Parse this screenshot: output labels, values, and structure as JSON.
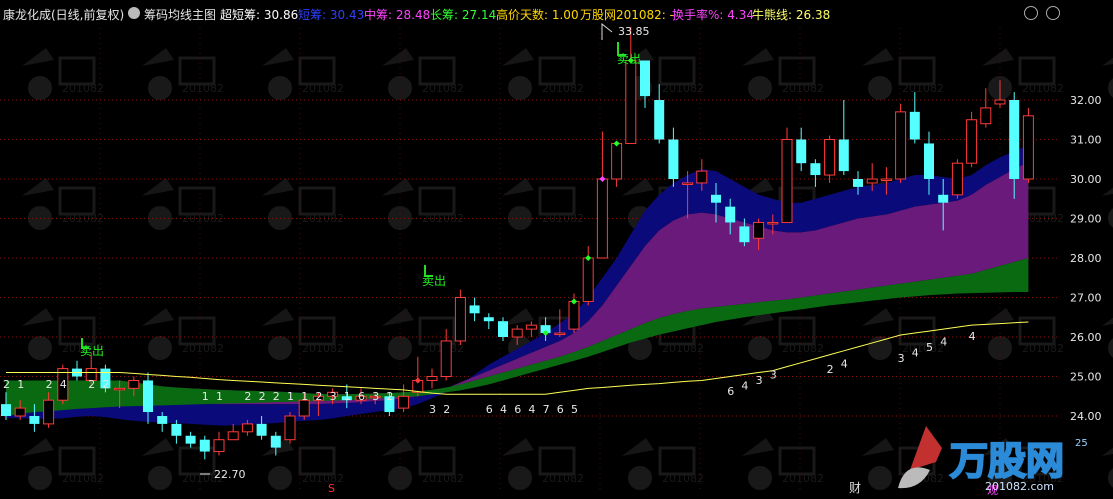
{
  "header": {
    "stock_name": "康龙化成(日线,前复权)",
    "indicator_name": "筹码均线主图",
    "items": [
      {
        "label": "超短筹: 30.86",
        "color": "#ffffff"
      },
      {
        "label": "短筹: 30.43",
        "color": "#3040ff"
      },
      {
        "label": "中筹: 28.48",
        "color": "#ff44ff"
      },
      {
        "label": "长筹: 27.14",
        "color": "#33ff33"
      },
      {
        "label": "高价天数: 1.00",
        "color": "#ffd700"
      },
      {
        "label": "万股网201082: -",
        "color": "#ffd700"
      },
      {
        "label": "换手率%: 4.34",
        "color": "#ff44ff"
      },
      {
        "label": "牛熊线: 26.38",
        "color": "#ffff66"
      }
    ]
  },
  "axis": {
    "y_labels": [
      "32.00",
      "31.00",
      "30.00",
      "29.00",
      "28.00",
      "27.00",
      "26.00",
      "25.00",
      "24.00"
    ],
    "partial_label": "25"
  },
  "annotations": {
    "high_price": "33.85",
    "low_price": "22.70",
    "sell_label": "卖出",
    "bottom_marker_s": "S",
    "bottom_marker_cai": "财",
    "bottom_marker_guan": "观"
  },
  "watermark": {
    "brand": "万股网",
    "url": "201082.com"
  },
  "chart_data": {
    "type": "candlestick",
    "ylim": [
      23.3,
      33.9
    ],
    "candles": [
      [
        24.3,
        24.0,
        24.6,
        23.9
      ],
      [
        24.0,
        24.2,
        24.4,
        23.9
      ],
      [
        24.0,
        23.8,
        24.3,
        23.6
      ],
      [
        23.8,
        24.4,
        24.6,
        23.7
      ],
      [
        24.4,
        25.2,
        25.3,
        24.3
      ],
      [
        25.2,
        25.0,
        25.4,
        24.9
      ],
      [
        24.9,
        25.2,
        25.6,
        24.8
      ],
      [
        25.2,
        24.7,
        25.3,
        24.6
      ],
      [
        24.7,
        24.7,
        24.9,
        24.2
      ],
      [
        24.7,
        24.9,
        25.0,
        24.5
      ],
      [
        24.9,
        24.1,
        25.1,
        23.8
      ],
      [
        24.0,
        23.8,
        24.1,
        23.6
      ],
      [
        23.8,
        23.5,
        23.9,
        23.3
      ],
      [
        23.5,
        23.3,
        23.6,
        23.2
      ],
      [
        23.4,
        23.1,
        23.5,
        22.9
      ],
      [
        23.1,
        23.4,
        23.6,
        23.0
      ],
      [
        23.4,
        23.6,
        23.8,
        23.4
      ],
      [
        23.6,
        23.8,
        23.9,
        23.5
      ],
      [
        23.8,
        23.5,
        24.0,
        23.4
      ],
      [
        23.5,
        23.2,
        23.6,
        23.0
      ],
      [
        23.4,
        24.0,
        24.1,
        23.3
      ],
      [
        24.0,
        24.4,
        24.6,
        23.9
      ],
      [
        24.4,
        24.5,
        24.6,
        24.0
      ],
      [
        24.5,
        24.6,
        24.7,
        24.3
      ],
      [
        24.5,
        24.4,
        24.8,
        24.2
      ],
      [
        24.4,
        24.5,
        24.7,
        24.3
      ],
      [
        24.5,
        24.5,
        24.6,
        24.3
      ],
      [
        24.5,
        24.1,
        24.6,
        24.0
      ],
      [
        24.2,
        24.5,
        24.8,
        24.1
      ],
      [
        24.6,
        24.9,
        25.5,
        24.5
      ],
      [
        24.9,
        25.0,
        25.2,
        24.7
      ],
      [
        25.0,
        25.9,
        26.2,
        24.9
      ],
      [
        25.9,
        27.0,
        27.2,
        25.8
      ],
      [
        26.8,
        26.6,
        27.0,
        26.4
      ],
      [
        26.5,
        26.4,
        26.6,
        26.2
      ],
      [
        26.4,
        26.0,
        26.5,
        25.9
      ],
      [
        26.0,
        26.2,
        26.3,
        25.8
      ],
      [
        26.2,
        26.3,
        26.4,
        26.0
      ],
      [
        26.3,
        26.1,
        26.5,
        25.9
      ],
      [
        26.1,
        26.1,
        26.7,
        26.0
      ],
      [
        26.2,
        26.9,
        27.1,
        26.1
      ],
      [
        26.9,
        28.0,
        28.3,
        26.8
      ],
      [
        28.0,
        30.0,
        31.2,
        28.0
      ],
      [
        30.0,
        30.9,
        30.9,
        29.8
      ],
      [
        30.9,
        33.0,
        33.85,
        30.9
      ],
      [
        33.0,
        32.1,
        32.3,
        31.8
      ],
      [
        32.0,
        31.0,
        32.4,
        30.9
      ],
      [
        31.0,
        30.0,
        31.3,
        29.8
      ],
      [
        29.9,
        29.9,
        30.2,
        29.0
      ],
      [
        29.9,
        30.2,
        30.5,
        29.7
      ],
      [
        29.6,
        29.4,
        29.9,
        28.9
      ],
      [
        29.3,
        28.9,
        29.5,
        28.6
      ],
      [
        28.8,
        28.4,
        29.0,
        28.3
      ],
      [
        28.5,
        28.9,
        29.0,
        28.2
      ],
      [
        28.9,
        28.9,
        29.1,
        28.6
      ],
      [
        28.9,
        31.0,
        31.3,
        28.9
      ],
      [
        31.0,
        30.4,
        31.3,
        30.2
      ],
      [
        30.4,
        30.1,
        30.5,
        29.8
      ],
      [
        30.1,
        31.0,
        31.1,
        29.9
      ],
      [
        31.0,
        30.2,
        32.0,
        30.1
      ],
      [
        30.0,
        29.8,
        30.2,
        29.6
      ],
      [
        29.9,
        30.0,
        30.4,
        29.7
      ],
      [
        30.0,
        30.0,
        30.3,
        29.6
      ],
      [
        30.0,
        31.7,
        31.9,
        29.9
      ],
      [
        31.7,
        31.0,
        32.2,
        30.9
      ],
      [
        30.9,
        30.0,
        31.2,
        29.6
      ],
      [
        29.6,
        29.4,
        30.0,
        28.7
      ],
      [
        29.6,
        30.4,
        30.5,
        29.5
      ],
      [
        30.4,
        31.5,
        31.7,
        30.3
      ],
      [
        31.4,
        31.8,
        32.3,
        31.3
      ],
      [
        31.9,
        32.0,
        32.5,
        31.8
      ],
      [
        32.0,
        30.0,
        32.2,
        29.5
      ],
      [
        30.0,
        31.6,
        31.8,
        29.9
      ]
    ],
    "bands": {
      "super_short": [
        23.95,
        23.94,
        23.93,
        23.93,
        23.94,
        23.98,
        24.0,
        23.97,
        23.92,
        23.88,
        23.85,
        23.83,
        23.82,
        23.8,
        23.78,
        23.76,
        23.76,
        23.77,
        23.8,
        23.82,
        23.85,
        23.88,
        23.9,
        23.94,
        24.0,
        24.05,
        24.1,
        24.15,
        24.2,
        24.3,
        24.45,
        24.6,
        24.8,
        25.05,
        25.3,
        25.5,
        25.7,
        25.9,
        26.1,
        26.35,
        26.6,
        27.0,
        27.5,
        28.0,
        28.6,
        29.2,
        29.6,
        29.9,
        30.1,
        30.25,
        30.2,
        30.0,
        29.8,
        29.6,
        29.5,
        29.4,
        29.4,
        29.5,
        29.6,
        29.7,
        29.8,
        29.85,
        29.9,
        30.0,
        30.1,
        30.1,
        30.05,
        30.0,
        30.1,
        30.35,
        30.55,
        30.7,
        30.86
      ],
      "short": [
        24.6,
        24.6,
        24.6,
        24.55,
        24.55,
        24.6,
        24.6,
        24.6,
        24.55,
        24.5,
        24.45,
        24.4,
        24.38,
        24.35,
        24.33,
        24.3,
        24.3,
        24.3,
        24.3,
        24.3,
        24.3,
        24.3,
        24.3,
        24.32,
        24.33,
        24.35,
        24.38,
        24.4,
        24.45,
        24.5,
        24.6,
        24.7,
        24.85,
        25.0,
        25.15,
        25.3,
        25.45,
        25.6,
        25.75,
        25.9,
        26.1,
        26.4,
        26.8,
        27.3,
        27.8,
        28.3,
        28.7,
        28.95,
        29.1,
        29.15,
        29.1,
        29.0,
        28.9,
        28.8,
        28.7,
        28.65,
        28.65,
        28.7,
        28.8,
        28.9,
        29.0,
        29.05,
        29.1,
        29.2,
        29.3,
        29.35,
        29.4,
        29.45,
        29.6,
        29.85,
        30.05,
        30.25,
        30.43
      ],
      "mid": [
        24.9,
        24.9,
        24.9,
        24.9,
        24.9,
        24.9,
        24.9,
        24.9,
        24.9,
        24.85,
        24.8,
        24.75,
        24.72,
        24.7,
        24.68,
        24.66,
        24.65,
        24.64,
        24.63,
        24.62,
        24.6,
        24.58,
        24.56,
        24.55,
        24.55,
        24.56,
        24.57,
        24.58,
        24.6,
        24.62,
        24.66,
        24.72,
        24.8,
        24.9,
        25.0,
        25.1,
        25.2,
        25.3,
        25.4,
        25.5,
        25.62,
        25.75,
        25.9,
        26.05,
        26.2,
        26.35,
        26.48,
        26.58,
        26.66,
        26.72,
        26.76,
        26.8,
        26.84,
        26.88,
        26.92,
        26.95,
        27.0,
        27.05,
        27.1,
        27.15,
        27.2,
        27.25,
        27.3,
        27.35,
        27.4,
        27.45,
        27.5,
        27.55,
        27.6,
        27.7,
        27.8,
        27.9,
        28.0
      ],
      "long": [
        24.0,
        24.05,
        24.1,
        24.12,
        24.15,
        24.18,
        24.2,
        24.22,
        24.24,
        24.25,
        24.26,
        24.27,
        24.28,
        24.29,
        24.3,
        24.31,
        24.32,
        24.33,
        24.34,
        24.35,
        24.36,
        24.37,
        24.38,
        24.39,
        24.4,
        24.42,
        24.44,
        24.46,
        24.48,
        24.5,
        24.55,
        24.6,
        24.65,
        24.72,
        24.8,
        24.9,
        25.0,
        25.1,
        25.2,
        25.3,
        25.4,
        25.5,
        25.62,
        25.74,
        25.86,
        25.96,
        26.06,
        26.14,
        26.22,
        26.3,
        26.38,
        26.44,
        26.5,
        26.55,
        26.6,
        26.65,
        26.7,
        26.75,
        26.8,
        26.84,
        26.88,
        26.92,
        26.96,
        27.0,
        27.03,
        27.06,
        27.08,
        27.1,
        27.11,
        27.12,
        27.13,
        27.14,
        27.14
      ]
    },
    "bull_bear_line": [
      25.1,
      25.1,
      25.1,
      25.1,
      25.1,
      25.1,
      25.1,
      25.1,
      25.1,
      25.08,
      25.05,
      25.03,
      25.0,
      24.98,
      24.95,
      24.92,
      24.9,
      24.88,
      24.86,
      24.84,
      24.82,
      24.8,
      24.78,
      24.76,
      24.74,
      24.72,
      24.7,
      24.68,
      24.66,
      24.62,
      24.58,
      24.55,
      24.55,
      24.55,
      24.55,
      24.55,
      24.55,
      24.55,
      24.55,
      24.6,
      24.65,
      24.7,
      24.72,
      24.75,
      24.78,
      24.8,
      24.82,
      24.85,
      24.88,
      24.9,
      24.95,
      25.0,
      25.05,
      25.1,
      25.15,
      25.25,
      25.35,
      25.45,
      25.55,
      25.65,
      25.75,
      25.85,
      25.95,
      26.05,
      26.1,
      26.15,
      26.2,
      26.25,
      26.3,
      26.32,
      26.34,
      26.36,
      26.38
    ],
    "digit_row_1": [
      {
        "i": 0,
        "t": "2"
      },
      {
        "i": 1,
        "t": "1"
      },
      {
        "i": 3,
        "t": "2"
      },
      {
        "i": 4,
        "t": "4"
      },
      {
        "i": 6,
        "t": "2"
      },
      {
        "i": 7,
        "t": "2"
      },
      {
        "i": 14,
        "t": "1"
      },
      {
        "i": 15,
        "t": "1"
      },
      {
        "i": 17,
        "t": "2"
      },
      {
        "i": 18,
        "t": "2"
      },
      {
        "i": 19,
        "t": "2"
      },
      {
        "i": 20,
        "t": "1"
      },
      {
        "i": 21,
        "t": "1"
      },
      {
        "i": 22,
        "t": "2"
      },
      {
        "i": 23,
        "t": "3"
      },
      {
        "i": 24,
        "t": "1"
      },
      {
        "i": 25,
        "t": "6"
      },
      {
        "i": 26,
        "t": "3"
      },
      {
        "i": 27,
        "t": "2"
      },
      {
        "i": 30,
        "t": "3"
      },
      {
        "i": 31,
        "t": "2"
      },
      {
        "i": 34,
        "t": "6"
      },
      {
        "i": 35,
        "t": "4"
      },
      {
        "i": 36,
        "t": "6"
      },
      {
        "i": 37,
        "t": "4"
      },
      {
        "i": 38,
        "t": "7"
      },
      {
        "i": 39,
        "t": "6"
      },
      {
        "i": 40,
        "t": "5"
      }
    ],
    "digit_row_2": [
      {
        "i": 51,
        "t": "6"
      },
      {
        "i": 52,
        "t": "4"
      },
      {
        "i": 53,
        "t": "3"
      },
      {
        "i": 54,
        "t": "3"
      },
      {
        "i": 58,
        "t": "2"
      },
      {
        "i": 59,
        "t": "4"
      },
      {
        "i": 63,
        "t": "3"
      },
      {
        "i": 64,
        "t": "4"
      },
      {
        "i": 65,
        "t": "5"
      },
      {
        "i": 66,
        "t": "4"
      },
      {
        "i": 68,
        "t": "4"
      }
    ]
  }
}
